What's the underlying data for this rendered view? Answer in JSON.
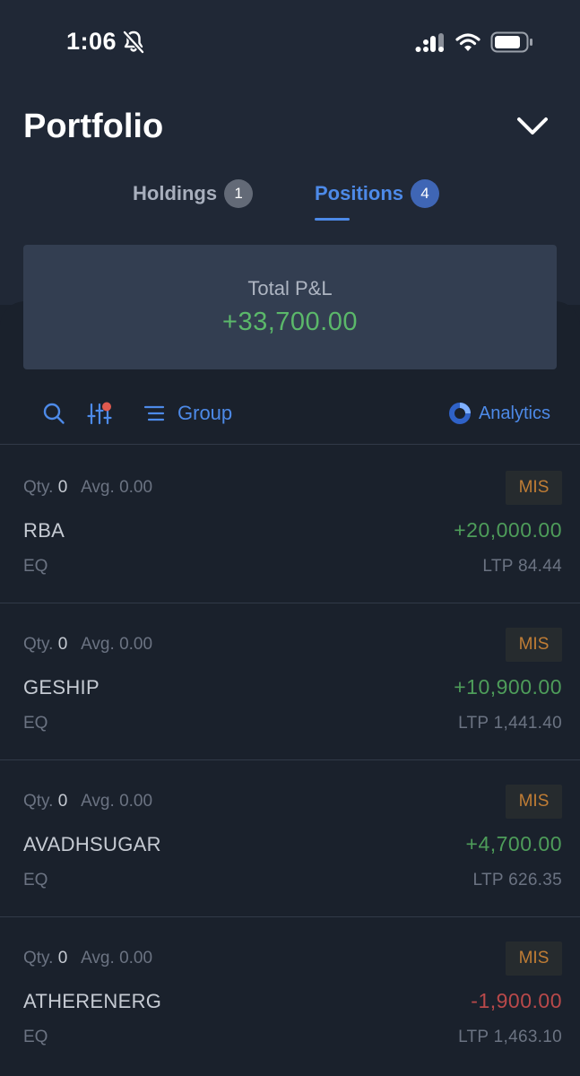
{
  "status_bar": {
    "time": "1:06",
    "icons": [
      "bell-slash-icon",
      "signal-icon",
      "wifi-icon",
      "battery-icon"
    ]
  },
  "header": {
    "title": "Portfolio",
    "collapse_icon": "chevron-down-icon"
  },
  "tabs": [
    {
      "label": "Holdings",
      "count": "1",
      "active": false
    },
    {
      "label": "Positions",
      "count": "4",
      "active": true
    }
  ],
  "summary": {
    "label": "Total P&L",
    "value": "+33,700.00"
  },
  "toolbar": {
    "search_icon": "search-icon",
    "filter_icon": "filter-sliders-icon",
    "group_label": "Group",
    "analytics_label": "Analytics"
  },
  "positions": [
    {
      "qty_label": "Qty.",
      "qty": "0",
      "avg_label": "Avg.",
      "avg": "0.00",
      "product": "MIS",
      "symbol": "RBA",
      "pnl": "+20,000.00",
      "exchange": "EQ",
      "ltp": "LTP 84.44"
    },
    {
      "qty_label": "Qty.",
      "qty": "0",
      "avg_label": "Avg.",
      "avg": "0.00",
      "product": "MIS",
      "symbol": "GESHIP",
      "pnl": "+10,900.00",
      "exchange": "EQ",
      "ltp": "LTP 1,441.40"
    },
    {
      "qty_label": "Qty.",
      "qty": "0",
      "avg_label": "Avg.",
      "avg": "0.00",
      "product": "MIS",
      "symbol": "AVADHSUGAR",
      "pnl": "+4,700.00",
      "exchange": "EQ",
      "ltp": "LTP 626.35"
    },
    {
      "qty_label": "Qty.",
      "qty": "0",
      "avg_label": "Avg.",
      "avg": "0.00",
      "product": "MIS",
      "symbol": "ATHERENERG",
      "pnl": "-1,900.00",
      "exchange": "EQ",
      "ltp": "LTP 1,463.10"
    }
  ],
  "colors": {
    "accent": "#4d8ae8",
    "profit": "#4e9d5a",
    "loss": "#b9494a",
    "product_badge": "#c07d35",
    "filter_dot": "#e05a4f"
  }
}
